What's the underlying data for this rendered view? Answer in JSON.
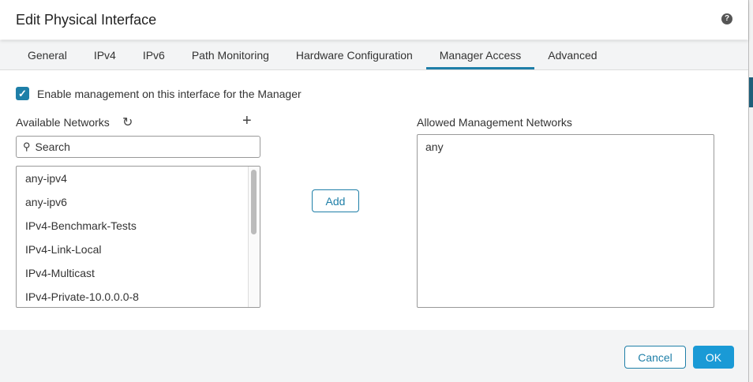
{
  "dialog": {
    "title": "Edit Physical Interface",
    "help_icon": "?"
  },
  "tabs": [
    {
      "label": "General"
    },
    {
      "label": "IPv4"
    },
    {
      "label": "IPv6"
    },
    {
      "label": "Path Monitoring"
    },
    {
      "label": "Hardware Configuration"
    },
    {
      "label": "Manager Access",
      "active": true
    },
    {
      "label": "Advanced"
    }
  ],
  "enable_checkbox": {
    "label": "Enable management on this interface for the Manager",
    "checked": true
  },
  "available": {
    "label": "Available Networks",
    "search_placeholder": "Search",
    "items": [
      "any-ipv4",
      "any-ipv6",
      "IPv4-Benchmark-Tests",
      "IPv4-Link-Local",
      "IPv4-Multicast",
      "IPv4-Private-10.0.0.0-8"
    ]
  },
  "add_button": "Add",
  "allowed": {
    "label": "Allowed Management Networks",
    "items": [
      "any"
    ]
  },
  "footer": {
    "cancel": "Cancel",
    "ok": "OK"
  },
  "colors": {
    "accent": "#1f7fa8",
    "ok": "#1a9ad6"
  }
}
